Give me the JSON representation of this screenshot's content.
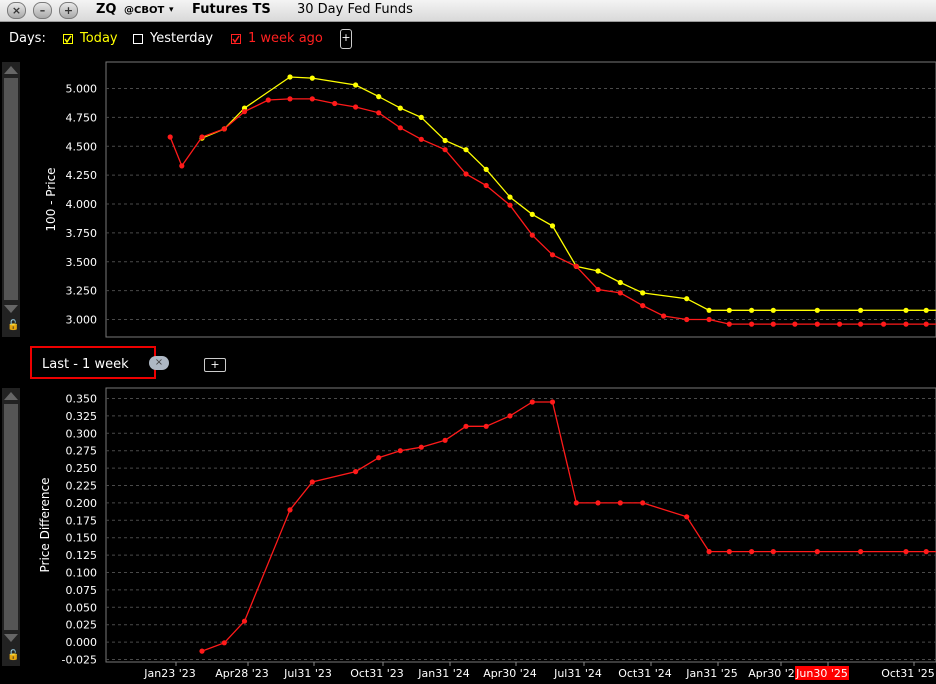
{
  "titlebar": {
    "symbol": "ZQ",
    "exchange": "@CBOT",
    "caret": "▾",
    "app_name": "Futures TS",
    "contract_name": "30 Day Fed Funds",
    "buttons": [
      "close-icon",
      "minimize-icon",
      "add-icon"
    ]
  },
  "days": {
    "label": "Days:",
    "items": [
      {
        "label": "Today",
        "checked": true,
        "color": "#ffff00"
      },
      {
        "label": "Yesterday",
        "checked": false,
        "color": "#ffffff"
      },
      {
        "label": "1 week ago",
        "checked": true,
        "color": "#ff2020"
      }
    ],
    "add_label": "+"
  },
  "lower_panel": {
    "label": "Last - 1 week",
    "close_label": "×",
    "add_label": "+"
  },
  "colors": {
    "today": "#ffff00",
    "week_ago": "#ff1a1a",
    "grid": "#4a4a4a",
    "axis_text": "#ffffff"
  },
  "chart_data": [
    {
      "type": "line",
      "ylabel": "100 - Price",
      "ylim": [
        2.9,
        5.2
      ],
      "yticks": [
        "5.000",
        "4.750",
        "4.500",
        "4.250",
        "4.000",
        "3.750",
        "3.500",
        "3.250",
        "3.000"
      ],
      "grid": true,
      "series": [
        {
          "name": "Today",
          "color": "#ffff00",
          "points": [
            [
              "2023-02-28",
              4.57
            ],
            [
              "2023-03-31",
              4.65
            ],
            [
              "2023-04-28",
              4.83
            ],
            [
              "2023-06-30",
              5.1
            ],
            [
              "2023-07-31",
              5.09
            ],
            [
              "2023-09-29",
              5.03
            ],
            [
              "2023-10-31",
              4.93
            ],
            [
              "2023-11-30",
              4.83
            ],
            [
              "2023-12-29",
              4.75
            ],
            [
              "2024-01-31",
              4.55
            ],
            [
              "2024-02-29",
              4.47
            ],
            [
              "2024-03-28",
              4.3
            ],
            [
              "2024-04-30",
              4.06
            ],
            [
              "2024-05-31",
              3.91
            ],
            [
              "2024-06-28",
              3.81
            ],
            [
              "2024-07-31",
              3.46
            ],
            [
              "2024-08-30",
              3.42
            ],
            [
              "2024-09-30",
              3.32
            ],
            [
              "2024-10-31",
              3.23
            ],
            [
              "2024-12-31",
              3.18
            ],
            [
              "2025-01-31",
              3.08
            ],
            [
              "2025-02-28",
              3.08
            ],
            [
              "2025-03-31",
              3.08
            ],
            [
              "2025-04-30",
              3.08
            ],
            [
              "2025-06-30",
              3.08
            ],
            [
              "2025-08-29",
              3.08
            ],
            [
              "2025-10-31",
              3.08
            ],
            [
              "2025-11-28",
              3.08
            ],
            [
              "2025-12-15",
              3.08
            ]
          ]
        },
        {
          "name": "1 week ago",
          "color": "#ff1a1a",
          "points": [
            [
              "2023-01-15",
              4.58
            ],
            [
              "2023-01-31",
              4.33
            ],
            [
              "2023-02-28",
              4.58
            ],
            [
              "2023-03-31",
              4.65
            ],
            [
              "2023-04-28",
              4.8
            ],
            [
              "2023-05-31",
              4.9
            ],
            [
              "2023-06-30",
              4.91
            ],
            [
              "2023-07-31",
              4.91
            ],
            [
              "2023-08-31",
              4.87
            ],
            [
              "2023-09-29",
              4.84
            ],
            [
              "2023-10-31",
              4.79
            ],
            [
              "2023-11-30",
              4.66
            ],
            [
              "2023-12-29",
              4.56
            ],
            [
              "2024-01-31",
              4.47
            ],
            [
              "2024-02-29",
              4.26
            ],
            [
              "2024-03-28",
              4.16
            ],
            [
              "2024-04-30",
              3.99
            ],
            [
              "2024-05-31",
              3.73
            ],
            [
              "2024-06-28",
              3.56
            ],
            [
              "2024-07-31",
              3.46
            ],
            [
              "2024-08-30",
              3.26
            ],
            [
              "2024-09-30",
              3.23
            ],
            [
              "2024-10-31",
              3.12
            ],
            [
              "2024-11-29",
              3.03
            ],
            [
              "2024-12-31",
              3.0
            ],
            [
              "2025-01-31",
              3.0
            ],
            [
              "2025-02-28",
              2.96
            ],
            [
              "2025-03-31",
              2.96
            ],
            [
              "2025-04-30",
              2.96
            ],
            [
              "2025-05-30",
              2.96
            ],
            [
              "2025-06-30",
              2.96
            ],
            [
              "2025-07-31",
              2.96
            ],
            [
              "2025-08-29",
              2.96
            ],
            [
              "2025-09-30",
              2.96
            ],
            [
              "2025-10-31",
              2.96
            ],
            [
              "2025-11-28",
              2.96
            ],
            [
              "2025-12-15",
              2.96
            ]
          ]
        }
      ]
    },
    {
      "type": "line",
      "ylabel": "Price Difference",
      "ylim": [
        -0.03,
        0.36
      ],
      "yticks": [
        "0.350",
        "0.325",
        "0.300",
        "0.275",
        "0.250",
        "0.225",
        "0.200",
        "0.175",
        "0.150",
        "0.125",
        "0.100",
        "0.075",
        "0.050",
        "0.025",
        "0.000",
        "-0.025"
      ],
      "xticks": [
        "Jan23 '23",
        "Apr28 '23",
        "Jul31 '23",
        "Oct31 '23",
        "Jan31 '24",
        "Apr30 '24",
        "Jul31 '24",
        "Oct31 '24",
        "Jan31 '25",
        "Apr30 '25",
        "Jun30 '25",
        "Oct31 '25"
      ],
      "highlighted_xtick": "Jun30 '25",
      "grid": true,
      "series": [
        {
          "name": "Last - 1 week",
          "color": "#ff1a1a",
          "points": [
            [
              "2023-02-28",
              -0.013
            ],
            [
              "2023-03-31",
              -0.001
            ],
            [
              "2023-04-28",
              0.03
            ],
            [
              "2023-06-30",
              0.19
            ],
            [
              "2023-07-31",
              0.23
            ],
            [
              "2023-09-29",
              0.245
            ],
            [
              "2023-10-31",
              0.265
            ],
            [
              "2023-11-30",
              0.275
            ],
            [
              "2023-12-29",
              0.28
            ],
            [
              "2024-01-31",
              0.29
            ],
            [
              "2024-02-29",
              0.31
            ],
            [
              "2024-03-28",
              0.31
            ],
            [
              "2024-04-30",
              0.325
            ],
            [
              "2024-05-31",
              0.345
            ],
            [
              "2024-06-28",
              0.345
            ],
            [
              "2024-07-31",
              0.2
            ],
            [
              "2024-08-30",
              0.2
            ],
            [
              "2024-09-30",
              0.2
            ],
            [
              "2024-10-31",
              0.2
            ],
            [
              "2024-12-31",
              0.18
            ],
            [
              "2025-01-31",
              0.13
            ],
            [
              "2025-02-28",
              0.13
            ],
            [
              "2025-03-31",
              0.13
            ],
            [
              "2025-04-30",
              0.13
            ],
            [
              "2025-06-30",
              0.13
            ],
            [
              "2025-08-29",
              0.13
            ],
            [
              "2025-10-31",
              0.13
            ],
            [
              "2025-11-28",
              0.13
            ],
            [
              "2025-12-15",
              0.13
            ]
          ]
        }
      ]
    }
  ]
}
